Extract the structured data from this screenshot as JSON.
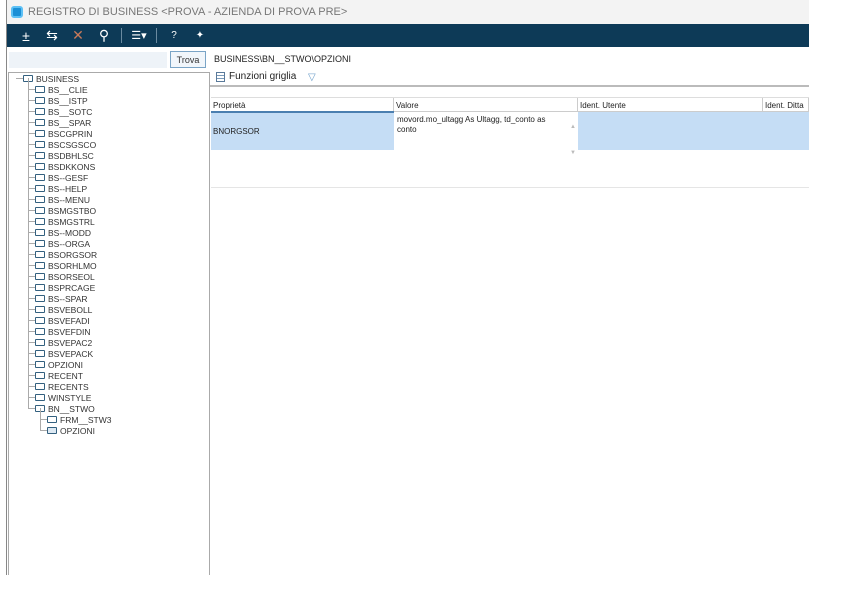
{
  "window": {
    "title": "REGISTRO DI BUSINESS <PROVA - AZIENDA DI PROVA PRE>"
  },
  "toolbar": {
    "icons": [
      "add-icon",
      "undo-icon",
      "delete-icon",
      "search-icon",
      "menu-icon",
      "help-icon",
      "assistant-icon"
    ],
    "glyphs": [
      "±",
      "⇆",
      "✕",
      "⚲",
      "☰▾",
      "?",
      "✦"
    ]
  },
  "search": {
    "value": "",
    "button": "Trova"
  },
  "tree": {
    "root": "BUSINESS",
    "children": [
      "BS__CLIE",
      "BS__ISTP",
      "BS__SOTC",
      "BS__SPAR",
      "BSCGPRIN",
      "BSCSGSCO",
      "BSDBHLSC",
      "BSDKKONS",
      "BS--GESF",
      "BS--HELP",
      "BS--MENU",
      "BSMGSTBO",
      "BSMGSTRL",
      "BS--MODD",
      "BS--ORGA",
      "BSORGSOR",
      "BSORHLMO",
      "BSORSEOL",
      "BSPRCAGE",
      "BS--SPAR",
      "BSVEBOLL",
      "BSVEFADI",
      "BSVEFDIN",
      "BSVEPAC2",
      "BSVEPACK",
      "OPZIONI",
      "RECENT",
      "RECENTS",
      "WINSTYLE",
      "BN__STWO"
    ],
    "sub": [
      "FRM__STW3",
      "OPZIONI"
    ]
  },
  "main": {
    "path": "BUSINESS\\BN__STWO\\OPZIONI",
    "grid_functions": "Funzioni griglia",
    "columns": [
      "Proprietà",
      "Valore",
      "Ident. Utente",
      "Ident. Ditta"
    ],
    "rows": [
      {
        "property": "BNORGSOR",
        "value": "movord.mo_ultagg As Ultagg, td_conto as conto",
        "user": "",
        "company": ""
      }
    ]
  },
  "colors": {
    "toolbar": "#0d3a57",
    "selection": "#c5ddf5"
  }
}
